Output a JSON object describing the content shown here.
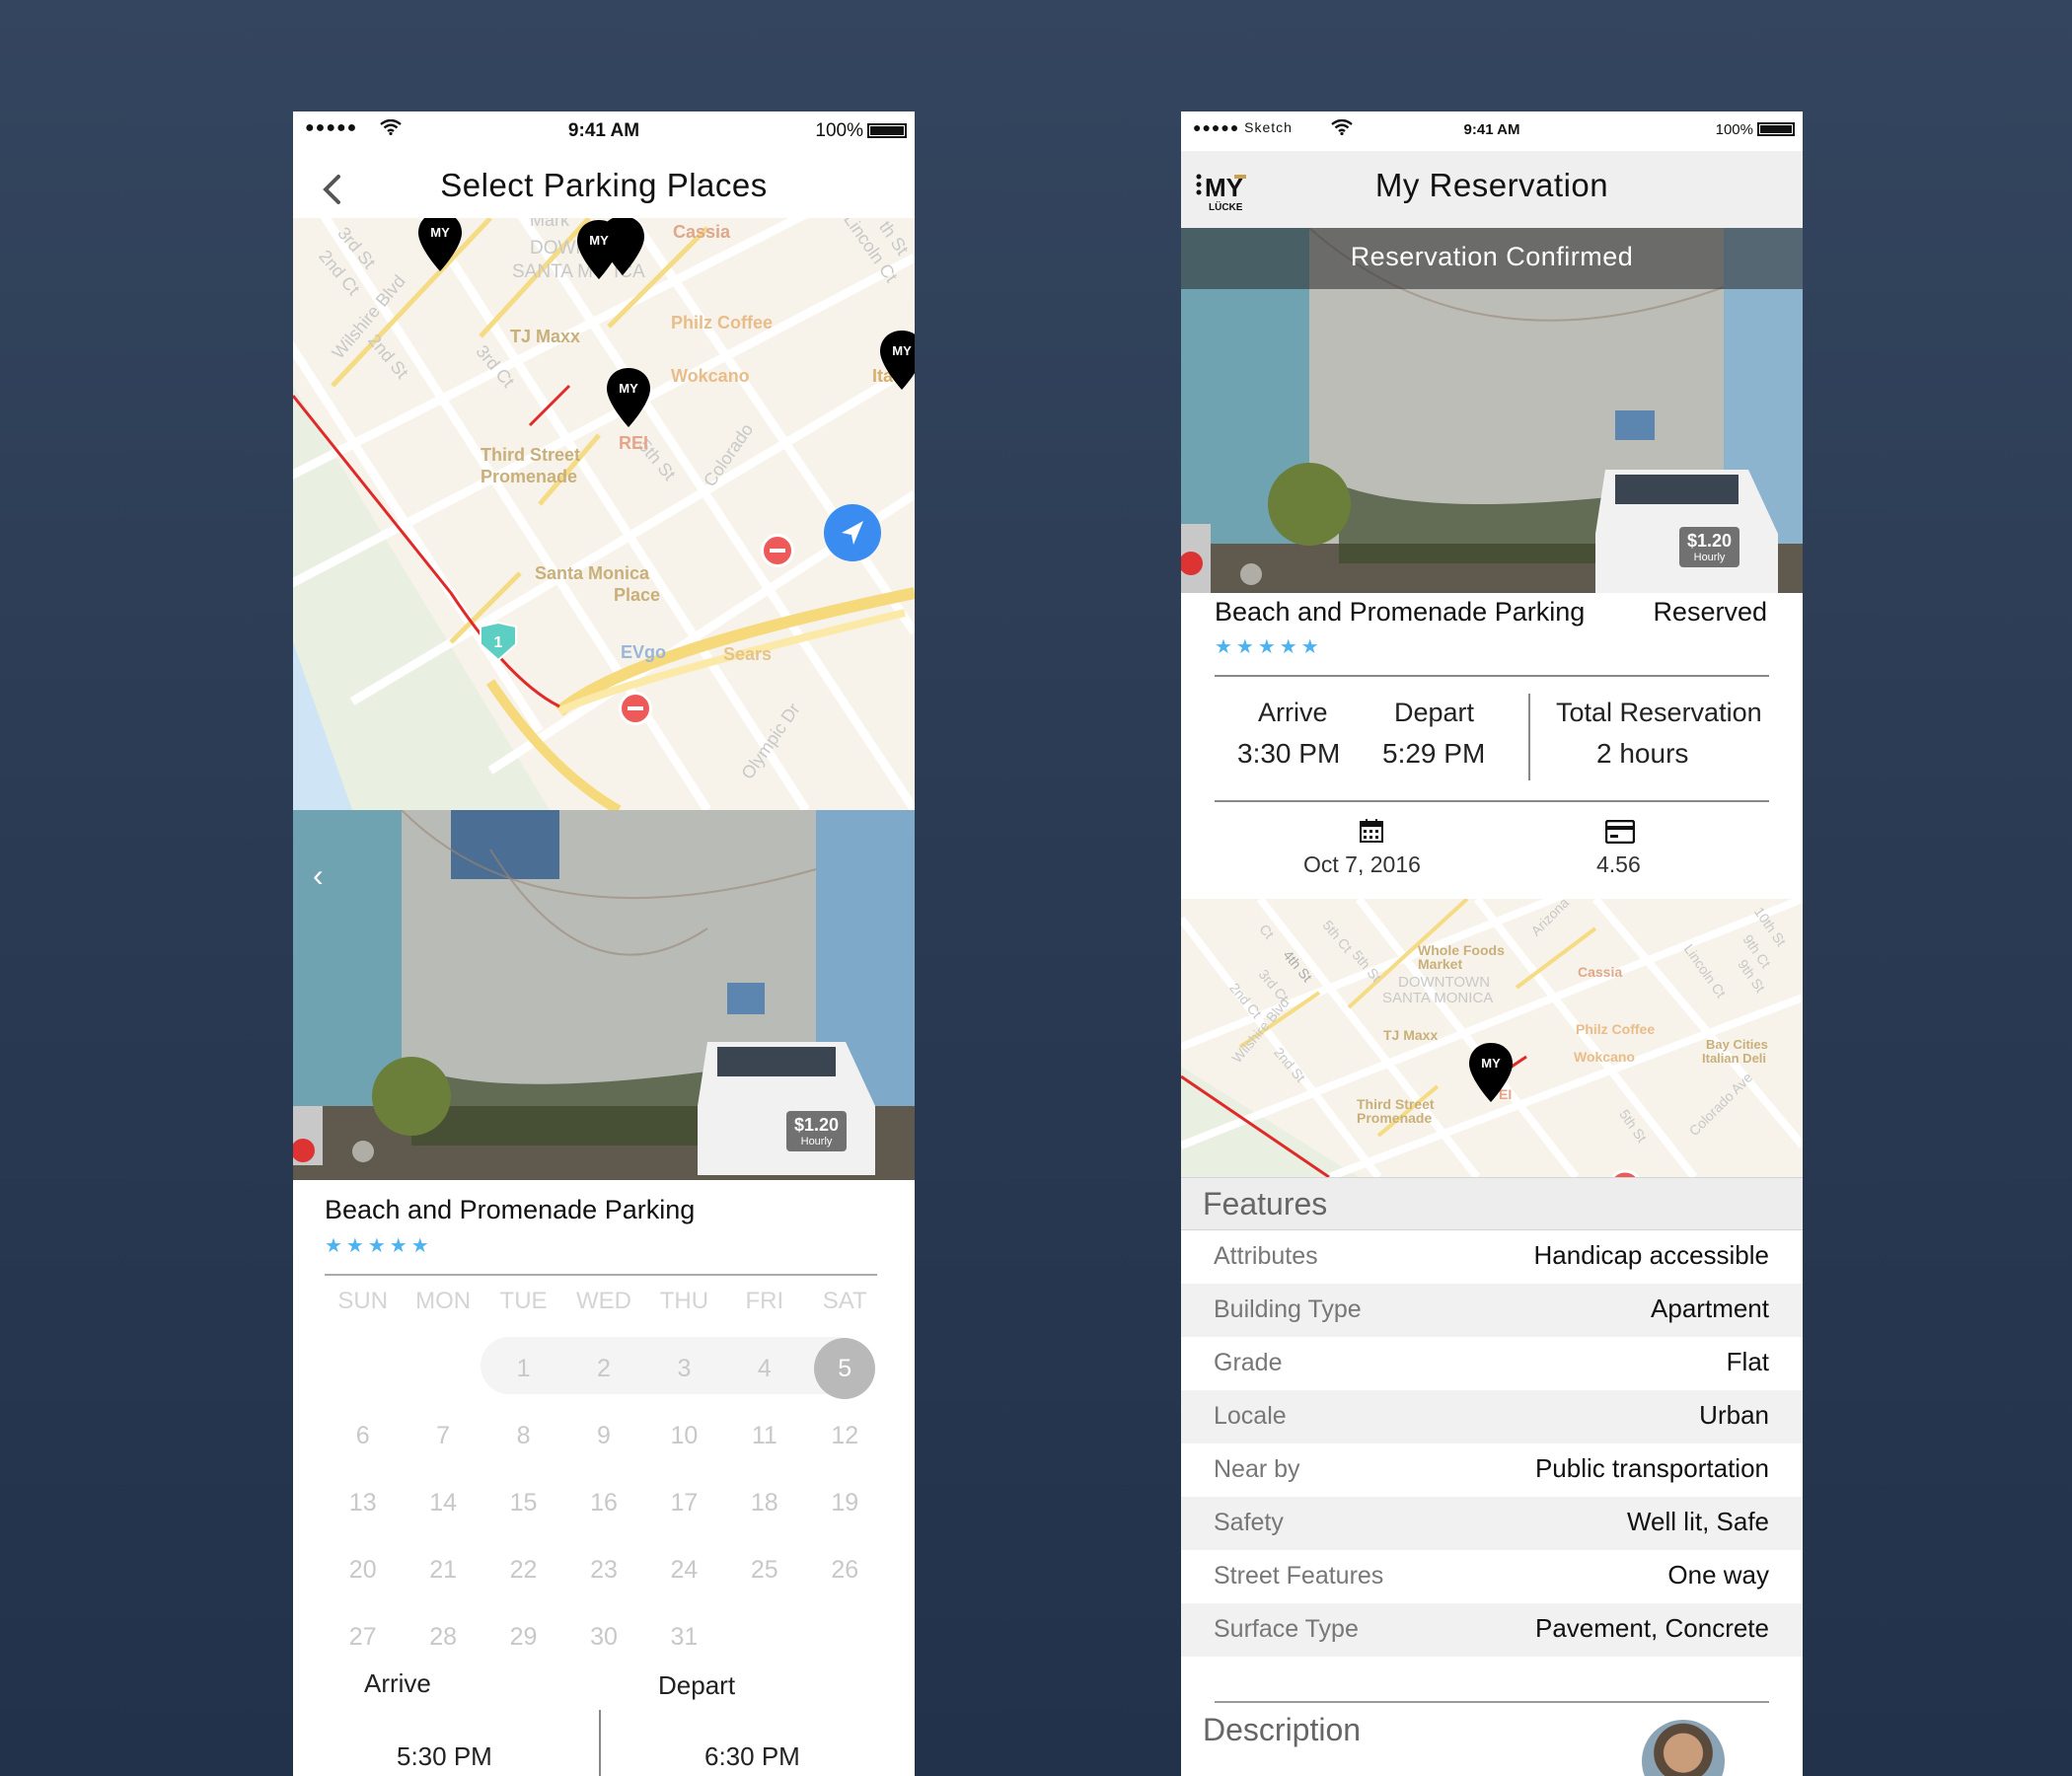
{
  "status": {
    "signal": "●●●●●",
    "carrier": "Sketch",
    "time": "9:41 AM",
    "battery": "100%"
  },
  "screen1": {
    "title": "Select Parking Places",
    "map_labels": {
      "cassia": "Cassia",
      "philz": "Philz Coffee",
      "tjmaxx": "TJ Maxx",
      "wokcano": "Wokcano",
      "rei": "REI",
      "third_street": "Third Street",
      "promenade": "Promenade",
      "santa_monica": "Santa Monica",
      "place": "Place",
      "evgo": "EVgo",
      "sears": "Sears",
      "downtown": "DOWN",
      "santa": "SANTA M",
      "onica": "ICA",
      "mark": "Mark",
      "ita": "Ita",
      "st3rd": "3rd St",
      "ct2nd": "2nd Ct",
      "wilshire": "Wilshire Blvd",
      "st2nd": "2nd St",
      "ct3rd": "3rd Ct",
      "st5th": "5th St",
      "colorado": "Colorado",
      "lincoln": "Lincoln Ct",
      "th": "th St",
      "olympic": "Olympic Dr",
      "route": "1"
    },
    "price": "$1.20",
    "price_unit": "Hourly",
    "lot_name": "Beach and Promenade Parking",
    "stars": "★★★★★",
    "days": [
      "SUN",
      "MON",
      "TUE",
      "WED",
      "THU",
      "FRI",
      "SAT"
    ],
    "calendar": [
      [
        "",
        "",
        "1",
        "2",
        "3",
        "4",
        "5"
      ],
      [
        "6",
        "7",
        "8",
        "9",
        "10",
        "11",
        "12"
      ],
      [
        "13",
        "14",
        "15",
        "16",
        "17",
        "18",
        "19"
      ],
      [
        "20",
        "21",
        "22",
        "23",
        "24",
        "25",
        "26"
      ],
      [
        "27",
        "28",
        "29",
        "30",
        "31",
        "",
        ""
      ]
    ],
    "selected_day": "5",
    "arrive_label": "Arrive",
    "depart_label": "Depart",
    "arrive_time": "5:30 PM",
    "depart_time": "6:30 PM"
  },
  "screen2": {
    "logo_text": "MY",
    "logo_sub": "LÜCKE",
    "title": "My  Reservation",
    "banner": "Reservation Confirmed",
    "price": "$1.20",
    "price_unit": "Hourly",
    "lot_name": "Beach and Promenade Parking",
    "status": "Reserved",
    "stars": "★★★★★",
    "arrive_label": "Arrive",
    "arrive_time": "3:30 PM",
    "depart_label": "Depart",
    "depart_time": "5:29 PM",
    "total_label": "Total Reservation",
    "total_value": "2 hours",
    "date": "Oct 7,  2016",
    "amount": "4.56",
    "map_labels": {
      "whole": "Whole Foods",
      "market": "Market",
      "downtown": "DOWNTOWN",
      "smonica": "SANTA MONICA",
      "cassia": "Cassia",
      "tjmaxx": "TJ Maxx",
      "philz": "Philz Coffee",
      "wokcano": "Wokcano",
      "bay": "Bay Cities",
      "italian": "Italian Deli",
      "third": "Third Street",
      "promenade": "Promenade",
      "arizona": "Arizona",
      "wilshire": "Wilshire Blvd",
      "st4th": "4th St",
      "ct3rd": "3rd Ct",
      "ct2nd": "2nd Ct",
      "st5th": "5th St",
      "ct5th": "5th Ct",
      "ct": "Ct",
      "st10th": "10th St",
      "ct9th": "9th Ct",
      "st9th": "9th St",
      "lincoln": "Lincoln Ct",
      "colorado": "Colorado Ave",
      "st2nd": "2nd St",
      "rei": "EI"
    },
    "features_title": "Features",
    "features": [
      {
        "k": "Attributes",
        "v": "Handicap accessible"
      },
      {
        "k": "Building Type",
        "v": "Apartment"
      },
      {
        "k": "Grade",
        "v": "Flat"
      },
      {
        "k": "Locale",
        "v": "Urban"
      },
      {
        "k": "Near by",
        "v": "Public transportation"
      },
      {
        "k": "Safety",
        "v": "Well lit,  Safe"
      },
      {
        "k": "Street  Features",
        "v": "One way"
      },
      {
        "k": "Surface  Type",
        "v": "Pavement,  Concrete"
      }
    ],
    "description_title": "Description"
  },
  "colors": {
    "accent": "#4cb3f0",
    "locate": "#3b8cf0",
    "gold": "#c9a14a",
    "road_red": "#e02a2a"
  }
}
